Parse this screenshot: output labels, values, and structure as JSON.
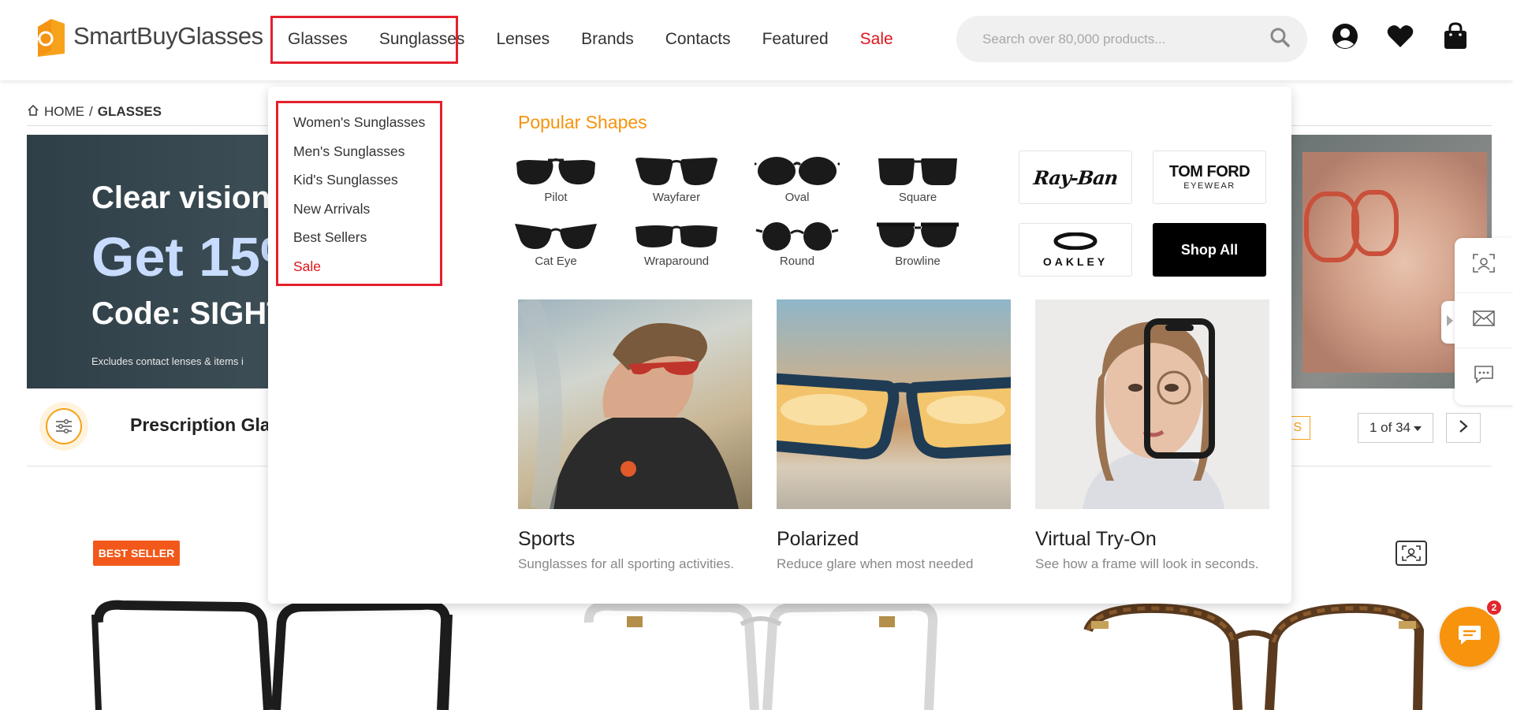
{
  "header": {
    "logo_text": "SmartBuyGlasses",
    "nav": [
      {
        "label": "Glasses",
        "sale": false
      },
      {
        "label": "Sunglasses",
        "sale": false
      },
      {
        "label": "Lenses",
        "sale": false
      },
      {
        "label": "Brands",
        "sale": false
      },
      {
        "label": "Contacts",
        "sale": false
      },
      {
        "label": "Featured",
        "sale": false
      },
      {
        "label": "Sale",
        "sale": true
      }
    ],
    "search_placeholder": "Search over 80,000 products...",
    "icons": [
      "account-icon",
      "wishlist-heart-icon",
      "shopping-bag-icon"
    ]
  },
  "breadcrumb": {
    "home": "HOME",
    "separator": "/",
    "current": "GLASSES"
  },
  "banner": {
    "line1": "Clear vision",
    "line2": "Get 15%",
    "line3": "Code: SIGHT",
    "footnote": "Excludes contact lenses & items i"
  },
  "listing": {
    "title": "Prescription Glas",
    "badge_partial": "S",
    "pagination": "1 of 34",
    "best_seller_badge": "BEST SELLER"
  },
  "mega_menu": {
    "list": [
      {
        "label": "Women's Sunglasses",
        "sale": false
      },
      {
        "label": "Men's Sunglasses",
        "sale": false
      },
      {
        "label": "Kid's Sunglasses",
        "sale": false
      },
      {
        "label": "New Arrivals",
        "sale": false
      },
      {
        "label": "Best Sellers",
        "sale": false
      },
      {
        "label": "Sale",
        "sale": true
      }
    ],
    "shapes_title": "Popular Shapes",
    "shapes": [
      "Pilot",
      "Wayfarer",
      "Oval",
      "Square",
      "Cat Eye",
      "Wraparound",
      "Round",
      "Browline"
    ],
    "brands": {
      "rayban": "Ray-Ban",
      "tomford": "TOM FORD",
      "tomford_sub": "EYEWEAR",
      "oakley": "OAKLEY",
      "shop_all": "Shop All"
    },
    "promos": [
      {
        "title": "Sports",
        "desc": "Sunglasses for all sporting activities."
      },
      {
        "title": "Polarized",
        "desc": "Reduce glare when most needed"
      },
      {
        "title": "Virtual Try-On",
        "desc": "See how a frame will look in seconds."
      }
    ]
  },
  "chat": {
    "badge_count": "2"
  },
  "colors": {
    "accent_orange": "#f7930d",
    "sale_red": "#e0121a",
    "highlight_red": "#e5202d",
    "best_seller": "#f1581a"
  }
}
